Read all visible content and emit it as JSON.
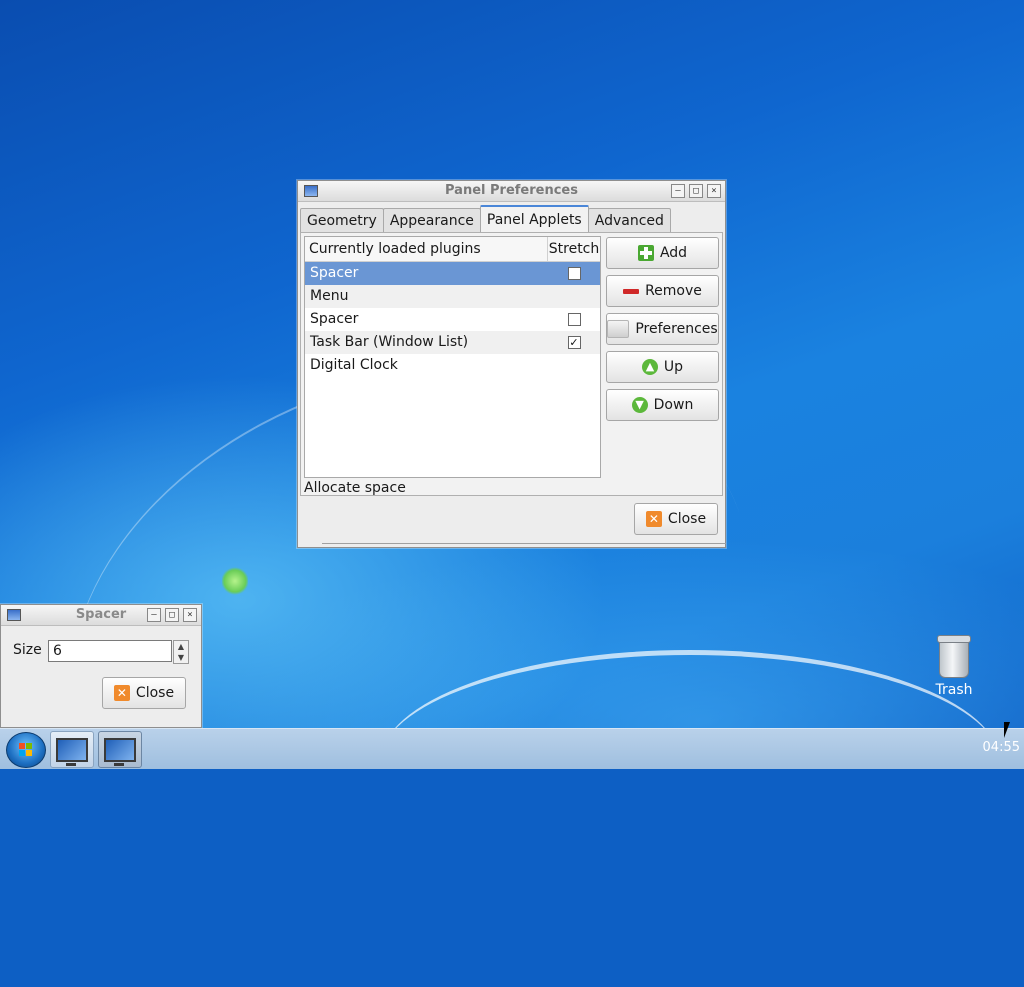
{
  "panel_prefs": {
    "title": "Panel Preferences",
    "tabs": [
      {
        "label": "Geometry"
      },
      {
        "label": "Appearance"
      },
      {
        "label": "Panel Applets"
      },
      {
        "label": "Advanced"
      }
    ],
    "list": {
      "header_name": "Currently loaded plugins",
      "header_stretch": "Stretch",
      "rows": [
        {
          "name": "Spacer",
          "stretch": "unchecked",
          "state": "selected"
        },
        {
          "name": "Menu",
          "stretch": "none"
        },
        {
          "name": "Spacer",
          "stretch": "unchecked"
        },
        {
          "name": "Task Bar (Window List)",
          "stretch": "checked"
        },
        {
          "name": "Digital Clock",
          "stretch": "none"
        }
      ]
    },
    "status": "Allocate space",
    "buttons": {
      "add": "Add",
      "remove": "Remove",
      "preferences": "Preferences",
      "up": "Up",
      "down": "Down",
      "close": "Close"
    }
  },
  "spacer_dialog": {
    "title": "Spacer",
    "size_label": "Size",
    "size_value": "6",
    "close": "Close"
  },
  "desktop": {
    "trash_label": "Trash"
  },
  "taskbar": {
    "clock": "04:55"
  },
  "icons": {
    "add": "green-plus-icon",
    "remove": "red-minus-icon",
    "up": "green-up-arrow-icon",
    "down": "green-down-arrow-icon",
    "close": "orange-x-icon"
  }
}
